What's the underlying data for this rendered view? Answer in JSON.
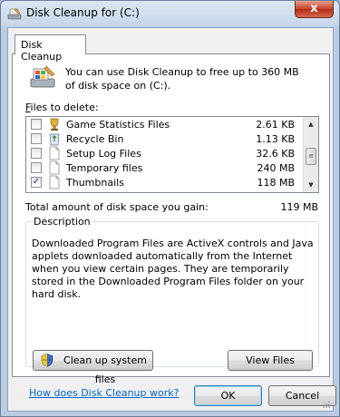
{
  "window": {
    "title": "Disk Cleanup for  (C:)",
    "close_label": "x"
  },
  "tab": {
    "label": "Disk Cleanup"
  },
  "intro": {
    "text": "You can use Disk Cleanup to free up to 360 MB of disk space on  (C:)."
  },
  "files": {
    "label_prefix": "",
    "label_underlined": "F",
    "label_rest": "iles to delete:",
    "items": [
      {
        "name": "Game Statistics Files",
        "size": "2.61 KB",
        "checked": false,
        "icon": "game-stats-icon"
      },
      {
        "name": "Recycle Bin",
        "size": "1.13 KB",
        "checked": false,
        "icon": "recycle-bin-icon"
      },
      {
        "name": "Setup Log Files",
        "size": "32.6 KB",
        "checked": false,
        "icon": "file-icon"
      },
      {
        "name": "Temporary files",
        "size": "240 MB",
        "checked": false,
        "icon": "file-icon"
      },
      {
        "name": "Thumbnails",
        "size": "118 MB",
        "checked": true,
        "icon": "file-icon"
      }
    ]
  },
  "total": {
    "label": "Total amount of disk space you gain:",
    "value": "119 MB"
  },
  "description": {
    "title": "Description",
    "text": "Downloaded Program Files are ActiveX controls and Java applets downloaded automatically from the Internet when you view certain pages. They are temporarily stored in the Downloaded Program Files folder on your hard disk."
  },
  "buttons": {
    "cleanup_system": "Clean up system files",
    "view_files": "View Files",
    "ok": "OK",
    "cancel": "Cancel"
  },
  "help_link": "How does Disk Cleanup work?",
  "colors": {
    "link": "#0066cc",
    "close_button": "#c7432a",
    "titlebar": "#c6d6ea"
  }
}
